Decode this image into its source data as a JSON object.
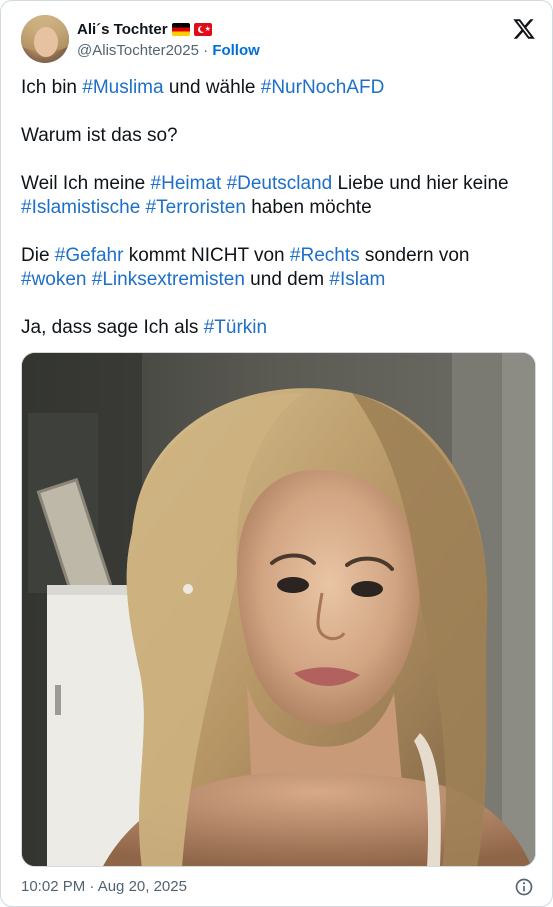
{
  "author": {
    "display_name": "Ali´s Tochter",
    "handle": "@AlisTochter2025",
    "separator": " · ",
    "follow_label": "Follow",
    "flags": [
      "germany-flag-icon",
      "turkey-flag-icon"
    ]
  },
  "brand": {
    "logo": "x-logo-icon"
  },
  "tweet": {
    "lines": [
      [
        {
          "text": "Ich bin "
        },
        {
          "text": "#Muslima",
          "hashtag": true
        },
        {
          "text": " und wähle "
        },
        {
          "text": "#NurNochAFD",
          "hashtag": true
        }
      ],
      [],
      [
        {
          "text": "Warum ist das so?"
        }
      ],
      [],
      [
        {
          "text": "Weil Ich meine "
        },
        {
          "text": "#Heimat",
          "hashtag": true
        },
        {
          "text": " "
        },
        {
          "text": "#Deutscland",
          "hashtag": true
        },
        {
          "text": " Liebe und hier keine"
        }
      ],
      [
        {
          "text": "#Islamistische",
          "hashtag": true
        },
        {
          "text": " "
        },
        {
          "text": "#Terroristen",
          "hashtag": true
        },
        {
          "text": " haben möchte"
        }
      ],
      [],
      [
        {
          "text": "Die "
        },
        {
          "text": "#Gefahr",
          "hashtag": true
        },
        {
          "text": " kommt NICHT von "
        },
        {
          "text": "#Rechts",
          "hashtag": true
        },
        {
          "text": " sondern von"
        }
      ],
      [
        {
          "text": "#woken",
          "hashtag": true
        },
        {
          "text": " "
        },
        {
          "text": "#Linksextremisten",
          "hashtag": true
        },
        {
          "text": " und dem "
        },
        {
          "text": "#Islam",
          "hashtag": true
        }
      ],
      [],
      [
        {
          "text": "Ja, dass sage Ich als "
        },
        {
          "text": "#Türkin",
          "hashtag": true
        }
      ]
    ]
  },
  "media": {
    "kind": "photo"
  },
  "footer": {
    "timestamp": "10:02 PM · Aug 20, 2025",
    "info_icon": "info-icon"
  },
  "colors": {
    "hashtag": "#1d6fc9",
    "follow": "#006fd6",
    "secondary_text": "#536471",
    "border": "#cfd9de"
  }
}
